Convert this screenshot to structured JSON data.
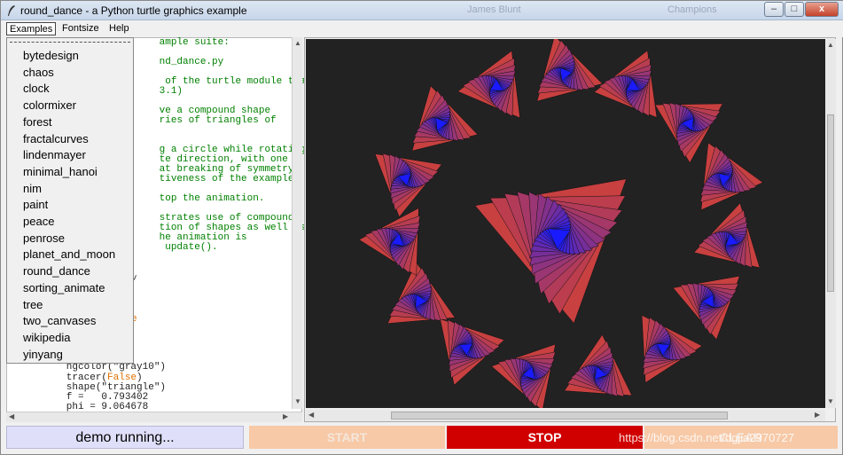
{
  "window": {
    "title": "round_dance - a Python turtle graphics example",
    "ghost_title_1": "James Blunt",
    "ghost_title_2": "Champions",
    "minimize": "–",
    "maximize": "□",
    "close": "x"
  },
  "menubar": {
    "items": [
      "Examples",
      "Fontsize",
      "Help"
    ]
  },
  "examples_menu": {
    "items": [
      "bytedesign",
      "chaos",
      "clock",
      "colormixer",
      "forest",
      "fractalcurves",
      "lindenmayer",
      "minimal_hanoi",
      "nim",
      "paint",
      "peace",
      "penrose",
      "planet_and_moon",
      "round_dance",
      "sorting_animate",
      "tree",
      "two_canvases",
      "wikipedia",
      "yinyang"
    ]
  },
  "code": {
    "lines": [
      "                          ample suite:",
      "",
      "                          nd_dance.py",
      "",
      "                           of the turtle module that",
      "                          3.1)",
      "",
      "                          ve a compound shape",
      "                          ries of triangles of",
      "",
      "",
      "                          g a circle while rotating",
      "                          te direction, with one",
      "                          at breaking of symmetry",
      "                          tiveness of the example?",
      "",
      "                          top the animation.",
      "",
      "                          strates use of compound",
      "                          tion of shapes as well as",
      "                          he animation is",
      "                           update()."
    ],
    "bottom_line_1": "        ngcolor(\"gray10\")",
    "bottom_line_2": "        tracer(",
    "bottom_line_2b": "False",
    "bottom_line_2c": ")",
    "bottom_line_3": "        shape(\"triangle\")",
    "bottom_line_4": "        f =   0.793402",
    "bottom_line_5": "        phi = 9.064678",
    "e_char": "e",
    "caret": "˅"
  },
  "controls": {
    "status": "demo running...",
    "start": "START",
    "stop": "STOP",
    "clear": "CLEAR"
  },
  "watermark": "https://blog.csdn.net/dgjia2970727",
  "colors": {
    "canvas_bg": "#222222",
    "triangle_outer": "#c84040",
    "triangle_inner": "#1a1aff",
    "stop_bg": "#d00000",
    "start_bg": "#f7c9a7",
    "status_bg": "#dfdffa"
  }
}
